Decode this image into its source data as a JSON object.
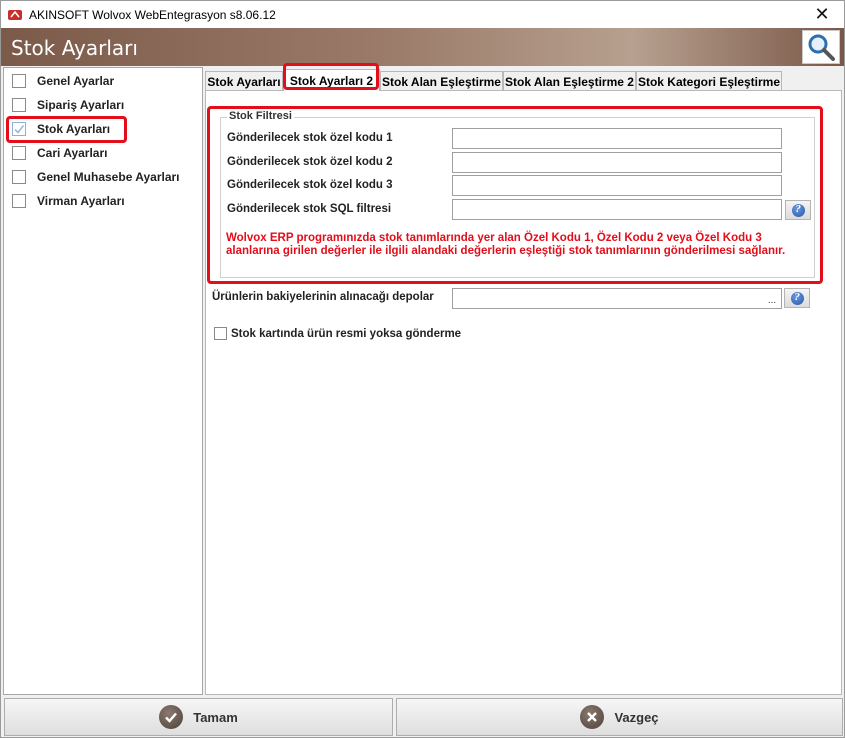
{
  "window": {
    "title": "AKINSOFT Wolvox WebEntegrasyon s8.06.12",
    "close_glyph": "✕"
  },
  "header": {
    "title": "Stok Ayarları"
  },
  "sidebar": {
    "items": [
      {
        "label": "Genel Ayarlar",
        "checked": false
      },
      {
        "label": "Sipariş Ayarları",
        "checked": false
      },
      {
        "label": "Stok Ayarları",
        "checked": true
      },
      {
        "label": "Cari Ayarları",
        "checked": false
      },
      {
        "label": "Genel Muhasebe Ayarları",
        "checked": false
      },
      {
        "label": "Virman Ayarları",
        "checked": false
      }
    ]
  },
  "tabs": [
    {
      "label": "Stok Ayarları"
    },
    {
      "label": "Stok Ayarları 2",
      "active": true
    },
    {
      "label": "Stok Alan Eşleştirme"
    },
    {
      "label": "Stok Alan Eşleştirme 2"
    },
    {
      "label": "Stok Kategori Eşleştirme"
    }
  ],
  "stock_filter": {
    "group_title": "Stok Filtresi",
    "fields": [
      {
        "label": "Gönderilecek stok özel kodu 1",
        "value": ""
      },
      {
        "label": "Gönderilecek stok özel kodu 2",
        "value": ""
      },
      {
        "label": "Gönderilecek stok özel kodu 3",
        "value": ""
      },
      {
        "label": "Gönderilecek stok SQL filtresi",
        "value": ""
      }
    ],
    "warning": "Wolvox ERP programınızda stok tanımlarında yer alan Özel Kodu 1, Özel Kodu 2 veya Özel Kodu 3 alanlarına girilen değerler ile ilgili alandaki değerlerin eşleştiği stok tanımlarının gönderilmesi sağlanır."
  },
  "depots": {
    "label": "Ürünlerin bakiyelerinin alınacağı depolar",
    "value": "",
    "ellipsis": "..."
  },
  "image_option": {
    "label": "Stok kartında ürün resmi yoksa gönderme",
    "checked": false
  },
  "help_glyph": "?",
  "buttons": {
    "ok": "Tamam",
    "cancel": "Vazgeç"
  },
  "colors": {
    "highlight": "#e20e1a",
    "banner": "#7b5a4a"
  }
}
